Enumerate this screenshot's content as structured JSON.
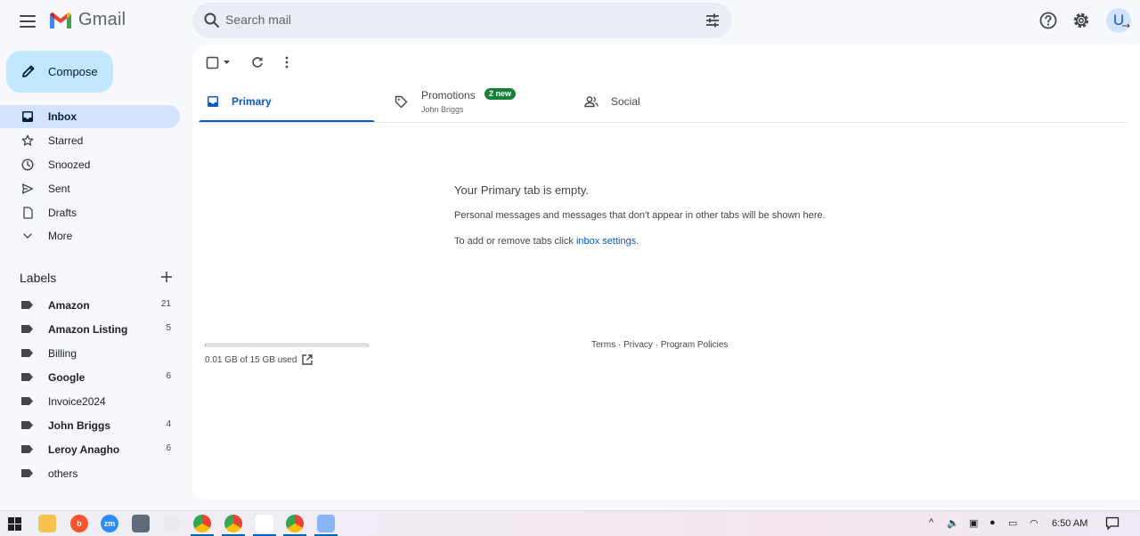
{
  "header": {
    "app_name": "Gmail",
    "search_placeholder": "Search mail",
    "avatar_letter": "U"
  },
  "sidebar": {
    "compose_label": "Compose",
    "nav": [
      {
        "label": "Inbox",
        "icon": "inbox-icon",
        "active": true
      },
      {
        "label": "Starred",
        "icon": "star-icon"
      },
      {
        "label": "Snoozed",
        "icon": "clock-icon"
      },
      {
        "label": "Sent",
        "icon": "send-icon"
      },
      {
        "label": "Drafts",
        "icon": "draft-icon"
      },
      {
        "label": "More",
        "icon": "chevron-down-icon"
      }
    ],
    "labels_title": "Labels",
    "labels": [
      {
        "name": "Amazon",
        "count": "21",
        "bold": true
      },
      {
        "name": "Amazon Listing",
        "count": "5",
        "bold": true
      },
      {
        "name": "Billing",
        "count": "",
        "bold": false
      },
      {
        "name": "Google",
        "count": "6",
        "bold": true
      },
      {
        "name": "Invoice2024",
        "count": "",
        "bold": false
      },
      {
        "name": "John Briggs",
        "count": "4",
        "bold": true
      },
      {
        "name": "Leroy Anagho",
        "count": "6",
        "bold": true
      },
      {
        "name": "others",
        "count": "",
        "bold": false
      }
    ]
  },
  "tabs": [
    {
      "label": "Primary",
      "active": true
    },
    {
      "label": "Promotions",
      "badge": "2 new",
      "sub": "John Briggs"
    },
    {
      "label": "Social"
    }
  ],
  "empty": {
    "title": "Your Primary tab is empty.",
    "description": "Personal messages and messages that don't appear in other tabs will be shown here.",
    "hint_prefix": "To add or remove tabs click ",
    "hint_link": "inbox settings",
    "hint_suffix": "."
  },
  "storage": {
    "text": "0.01 GB of 15 GB used",
    "used_fraction": 0.001
  },
  "footer": {
    "terms": "Terms",
    "privacy": "Privacy",
    "policies": "Program Policies",
    "separator": " · "
  },
  "taskbar": {
    "clock": "6:50 AM"
  },
  "colors": {
    "accent": "#0b57d0",
    "compose_bg": "#c2e7ff",
    "active_nav_bg": "#d3e3fd",
    "badge_green": "#188038"
  }
}
